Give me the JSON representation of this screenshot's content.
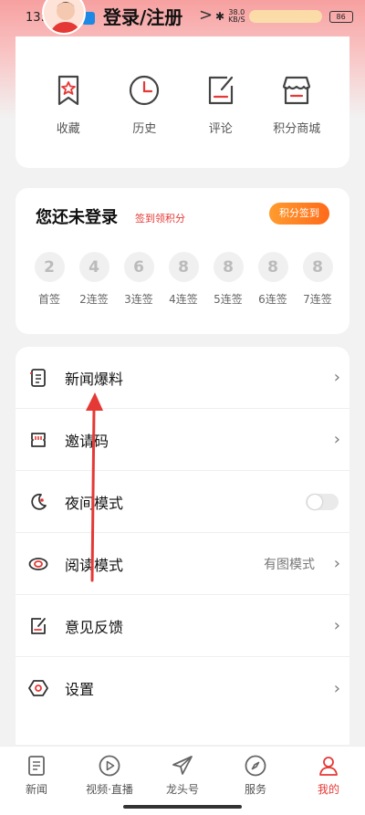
{
  "status": {
    "time": "13:50:56",
    "speed_top": "38.0",
    "speed_unit": "KB/S",
    "battery": "86"
  },
  "header": {
    "login_title": "登录/注册",
    "chevron": ">"
  },
  "quick_links": [
    {
      "label": "收藏",
      "icon": "bookmark-icon"
    },
    {
      "label": "历史",
      "icon": "clock-icon"
    },
    {
      "label": "评论",
      "icon": "edit-icon"
    },
    {
      "label": "积分商城",
      "icon": "store-icon"
    }
  ],
  "checkin": {
    "title": "您还未登录",
    "subtitle": "签到领积分",
    "button": "积分签到",
    "days": [
      {
        "points": "2",
        "label": "首签"
      },
      {
        "points": "4",
        "label": "2连签"
      },
      {
        "points": "6",
        "label": "3连签"
      },
      {
        "points": "8",
        "label": "4连签"
      },
      {
        "points": "8",
        "label": "5连签"
      },
      {
        "points": "8",
        "label": "6连签"
      },
      {
        "points": "8",
        "label": "7连签"
      }
    ]
  },
  "menu": [
    {
      "label": "新闻爆料",
      "icon": "document-icon",
      "type": "chevron"
    },
    {
      "label": "邀请码",
      "icon": "ticket-icon",
      "type": "chevron"
    },
    {
      "label": "夜间模式",
      "icon": "moon-icon",
      "type": "toggle",
      "toggle_on": false
    },
    {
      "label": "阅读模式",
      "icon": "eye-icon",
      "type": "value",
      "value": "有图模式"
    },
    {
      "label": "意见反馈",
      "icon": "feedback-icon",
      "type": "chevron"
    },
    {
      "label": "设置",
      "icon": "settings-icon",
      "type": "chevron"
    }
  ],
  "tabs": [
    {
      "label": "新闻",
      "icon": "news-icon",
      "active": false
    },
    {
      "label": "视频·直播",
      "icon": "play-icon",
      "active": false
    },
    {
      "label": "龙头号",
      "icon": "paper-plane-icon",
      "active": false
    },
    {
      "label": "服务",
      "icon": "compass-icon",
      "active": false
    },
    {
      "label": "我的",
      "icon": "user-icon",
      "active": true
    }
  ],
  "colors": {
    "accent": "#e53935",
    "orange": "#ff7a1f"
  }
}
